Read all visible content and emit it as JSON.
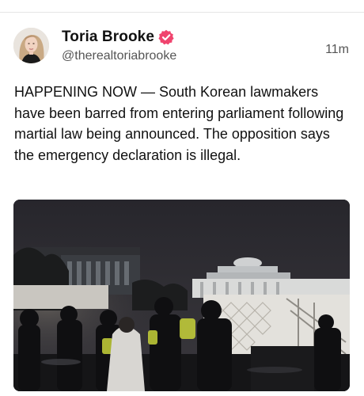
{
  "post": {
    "author": {
      "display_name": "Toria Brooke",
      "handle": "@therealtoriabrooke",
      "verified": true,
      "badge_color": "#f0446e"
    },
    "timestamp": "11m",
    "text": "HAPPENING NOW — South Korean lawmakers have been barred from entering parliament following martial law being announced. The opposition says the emergency declaration is illegal."
  },
  "icons": {
    "verified": "verified-badge-icon",
    "avatar": "profile-avatar"
  }
}
